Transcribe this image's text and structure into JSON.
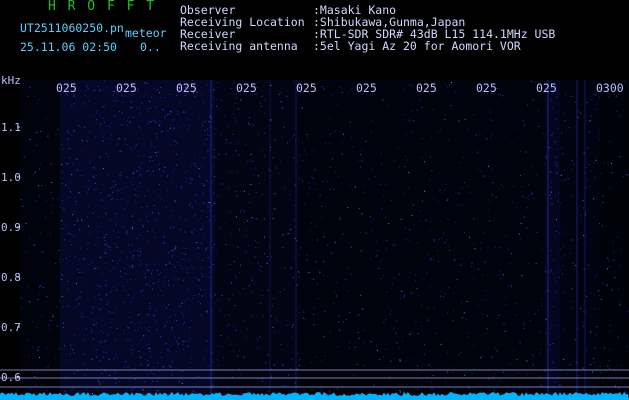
{
  "header": {
    "brand": "H R O F F T",
    "filename": "UT2511060250.pn",
    "meteor_label": "meteor",
    "datetime": "25.11.06 02:50",
    "flag": "0..",
    "info_rows": [
      {
        "label": "Observer",
        "value": ":Masaki Kano"
      },
      {
        "label": "Receiving Location",
        "value": ":Shibukawa,Gunma,Japan"
      },
      {
        "label": "Receiver",
        "value": ":RTL-SDR SDR# 43dB L15 114.1MHz USB"
      },
      {
        "label": "Receiving antenna",
        "value": ":5el Yagi Az 20 for Aomori VOR"
      }
    ]
  },
  "chart_data": {
    "type": "heatmap",
    "title": "",
    "xlabel": "",
    "ylabel": "kHz",
    "y_ticks": [
      "1.1",
      "1.0",
      "0.9",
      "0.8",
      "0.7",
      "0.6"
    ],
    "x_ticks": [
      "025",
      "025",
      "025",
      "025",
      "025",
      "025",
      "025",
      "025",
      "025",
      "0300"
    ],
    "colors": {
      "background": "#000000",
      "noise_low": "#060a3c",
      "noise_high": "#3c46ff",
      "baseline": "#00b4ff",
      "label": "#b8c0ff"
    }
  }
}
